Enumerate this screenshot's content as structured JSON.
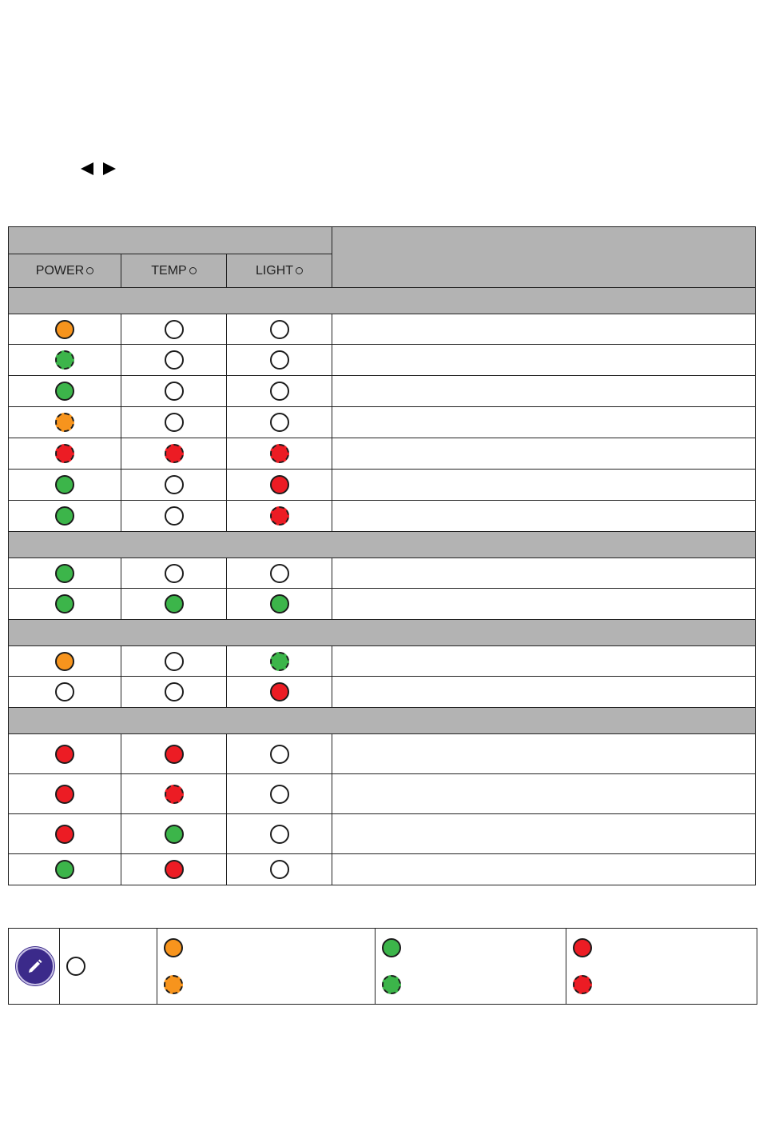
{
  "indicators": {
    "power": "POWER",
    "temp": "TEMP",
    "light": "LIGHT"
  },
  "colors": {
    "orange": "#f7941d",
    "green": "#3cb54a",
    "red": "#ec1c24",
    "off": "#ffffff",
    "header_gray": "#b3b3b3",
    "note_purple": "#3b2a8a"
  },
  "sections": [
    {
      "rows": [
        {
          "power": "orange",
          "temp": "off",
          "light": "off"
        },
        {
          "power": "green-blink",
          "temp": "off",
          "light": "off"
        },
        {
          "power": "green",
          "temp": "off",
          "light": "off"
        },
        {
          "power": "orange-blink",
          "temp": "off",
          "light": "off"
        },
        {
          "power": "red-blink",
          "temp": "red-blink",
          "light": "red-blink"
        },
        {
          "power": "green",
          "temp": "off",
          "light": "red"
        },
        {
          "power": "green",
          "temp": "off",
          "light": "red-blink"
        }
      ]
    },
    {
      "rows": [
        {
          "power": "green",
          "temp": "off",
          "light": "off"
        },
        {
          "power": "green",
          "temp": "green",
          "light": "green"
        }
      ]
    },
    {
      "rows": [
        {
          "power": "orange",
          "temp": "off",
          "light": "green-blink"
        },
        {
          "power": "off",
          "temp": "off",
          "light": "red"
        }
      ]
    },
    {
      "rows": [
        {
          "power": "red",
          "temp": "red",
          "light": "off"
        },
        {
          "power": "red",
          "temp": "red-blink",
          "light": "off"
        },
        {
          "power": "red",
          "temp": "green",
          "light": "off"
        },
        {
          "power": "green",
          "temp": "red",
          "light": "off"
        }
      ]
    }
  ],
  "legend": {
    "icon": "pencil-note-icon",
    "off": "off",
    "orange": [
      "orange",
      "orange-blink"
    ],
    "green": [
      "green",
      "green-blink"
    ],
    "red": [
      "red",
      "red-blink"
    ]
  }
}
